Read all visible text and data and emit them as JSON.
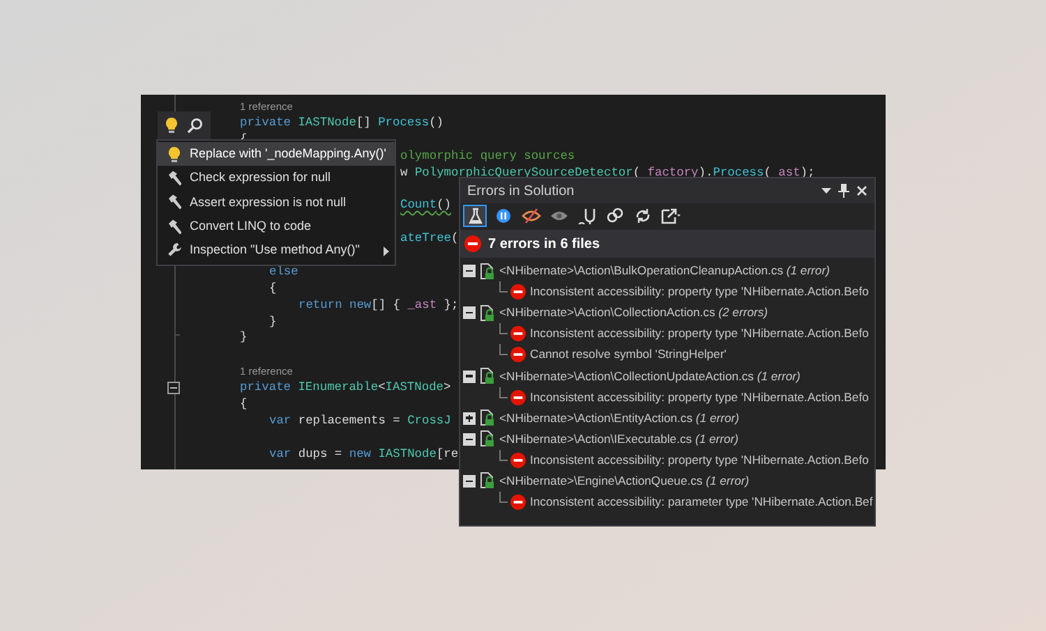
{
  "editor": {
    "lines": [
      {
        "kind": "reference",
        "text": "1 reference"
      },
      {
        "kind": "code",
        "tokens": [
          {
            "text": "private ",
            "kind": "keyword"
          },
          {
            "text": "IASTNode",
            "kind": "type"
          },
          {
            "text": "[] ",
            "kind": "plain"
          },
          {
            "text": "Process",
            "kind": "method"
          },
          {
            "text": "()",
            "kind": "plain"
          }
        ]
      },
      {
        "kind": "code",
        "tokens": [
          {
            "text": "{",
            "kind": "plain"
          }
        ]
      },
      {
        "kind": "partial",
        "tokens": [
          {
            "text": "olymorphic query sources",
            "kind": "comment"
          }
        ]
      },
      {
        "kind": "partial",
        "tokens": [
          {
            "text": "w ",
            "kind": "plain"
          },
          {
            "text": "PolymorphicQuerySourceDetector",
            "kind": "type"
          },
          {
            "text": "( ",
            "kind": "plain"
          },
          {
            "text": "factory",
            "kind": "param"
          },
          {
            "text": ").",
            "kind": "plain"
          },
          {
            "text": "Process",
            "kind": "method"
          },
          {
            "text": "( ",
            "kind": "plain"
          },
          {
            "text": "ast",
            "kind": "param"
          },
          {
            "text": ");",
            "kind": "plain"
          }
        ]
      },
      {
        "kind": "blank"
      },
      {
        "kind": "partial",
        "warning": true,
        "tokens": [
          {
            "text": "Count",
            "kind": "method"
          },
          {
            "text": "()",
            "kind": "plain"
          }
        ]
      },
      {
        "kind": "blank"
      },
      {
        "kind": "partial",
        "tokens": [
          {
            "text": "ateTree",
            "kind": "method"
          },
          {
            "text": "(",
            "kind": "plain"
          }
        ]
      },
      {
        "kind": "blank"
      },
      {
        "kind": "code",
        "tokens": [
          {
            "text": "else",
            "kind": "keyword"
          }
        ]
      },
      {
        "kind": "code",
        "tokens": [
          {
            "text": "{",
            "kind": "plain"
          }
        ]
      },
      {
        "kind": "code",
        "tokens": [
          {
            "text": "return ",
            "kind": "keyword"
          },
          {
            "text": "new",
            "kind": "keyword"
          },
          {
            "text": "[] { ",
            "kind": "plain"
          },
          {
            "text": "_ast",
            "kind": "param"
          },
          {
            "text": " };",
            "kind": "plain"
          }
        ]
      },
      {
        "kind": "code",
        "tokens": [
          {
            "text": "}",
            "kind": "plain"
          }
        ]
      },
      {
        "kind": "code",
        "tokens": [
          {
            "text": "}",
            "kind": "plain"
          }
        ]
      },
      {
        "kind": "blank"
      },
      {
        "kind": "reference",
        "text": "1 reference"
      },
      {
        "kind": "code",
        "expanded": true,
        "tokens": [
          {
            "text": "private ",
            "kind": "keyword"
          },
          {
            "text": "IEnumerable",
            "kind": "type"
          },
          {
            "text": "<",
            "kind": "plain"
          },
          {
            "text": "IASTNode",
            "kind": "type"
          },
          {
            "text": ">",
            "kind": "plain"
          }
        ]
      },
      {
        "kind": "code",
        "tokens": [
          {
            "text": "{",
            "kind": "plain"
          }
        ]
      },
      {
        "kind": "code",
        "tokens": [
          {
            "text": "var ",
            "kind": "keyword"
          },
          {
            "text": "replacements = ",
            "kind": "plain"
          },
          {
            "text": "CrossJ",
            "kind": "type"
          }
        ]
      },
      {
        "kind": "blank"
      },
      {
        "kind": "code",
        "tokens": [
          {
            "text": "var ",
            "kind": "keyword"
          },
          {
            "text": "dups = ",
            "kind": "plain"
          },
          {
            "text": "new ",
            "kind": "keyword"
          },
          {
            "text": "IASTNode",
            "kind": "type"
          },
          {
            "text": "[re",
            "kind": "plain"
          }
        ]
      }
    ]
  },
  "quick_fix_menu": {
    "items": [
      {
        "kind": "quick-fix",
        "label": "Replace with '_nodeMapping.Any()'",
        "selected": true
      },
      {
        "kind": "context-action",
        "label": "Check expression for null",
        "selected": false
      },
      {
        "kind": "context-action",
        "label": "Assert expression is not null",
        "selected": false
      },
      {
        "kind": "context-action",
        "label": "Convert LINQ to code",
        "selected": false
      },
      {
        "kind": "inspection",
        "label": "Inspection \"Use method Any()\"",
        "selected": false,
        "submenu": true
      }
    ]
  },
  "errors_window": {
    "title": "Errors in Solution",
    "toolbar": [
      {
        "selected": true
      },
      {
        "selected": false
      },
      {
        "selected": false
      },
      {
        "selected": false
      },
      {
        "selected": false
      },
      {
        "selected": false
      },
      {
        "selected": false
      },
      {
        "selected": false
      }
    ],
    "summary": "7 errors in 6 files",
    "files": [
      {
        "label": "<NHibernate>\\Action\\BulkOperationCleanupAction.cs *(1 error)*",
        "expanded": true,
        "children": [
          {
            "message": "Inconsistent accessibility: property type 'NHibernate.Action.Befo"
          }
        ]
      },
      {
        "label": "<NHibernate>\\Action\\CollectionAction.cs *(2 errors)*",
        "expanded": true,
        "children": [
          {
            "message": "Inconsistent accessibility: property type 'NHibernate.Action.Befo"
          },
          {
            "message": "Cannot resolve symbol 'StringHelper'"
          }
        ]
      },
      {
        "label": "<NHibernate>\\Action\\CollectionUpdateAction.cs *(1 error)*",
        "expanded": true,
        "children": [
          {
            "message": "Inconsistent accessibility: property type 'NHibernate.Action.Befo"
          }
        ]
      },
      {
        "label": "<NHibernate>\\Action\\EntityAction.cs *(1 error)*",
        "expanded": false
      },
      {
        "label": "<NHibernate>\\Action\\IExecutable.cs *(1 error)*",
        "expanded": true,
        "children": [
          {
            "message": "Inconsistent accessibility: property type 'NHibernate.Action.Befo"
          }
        ]
      },
      {
        "label": "<NHibernate>\\Engine\\ActionQueue.cs *(1 error)*",
        "expanded": true,
        "children": [
          {
            "message": "Inconsistent accessibility: parameter type 'NHibernate.Action.Bef"
          }
        ]
      }
    ]
  }
}
